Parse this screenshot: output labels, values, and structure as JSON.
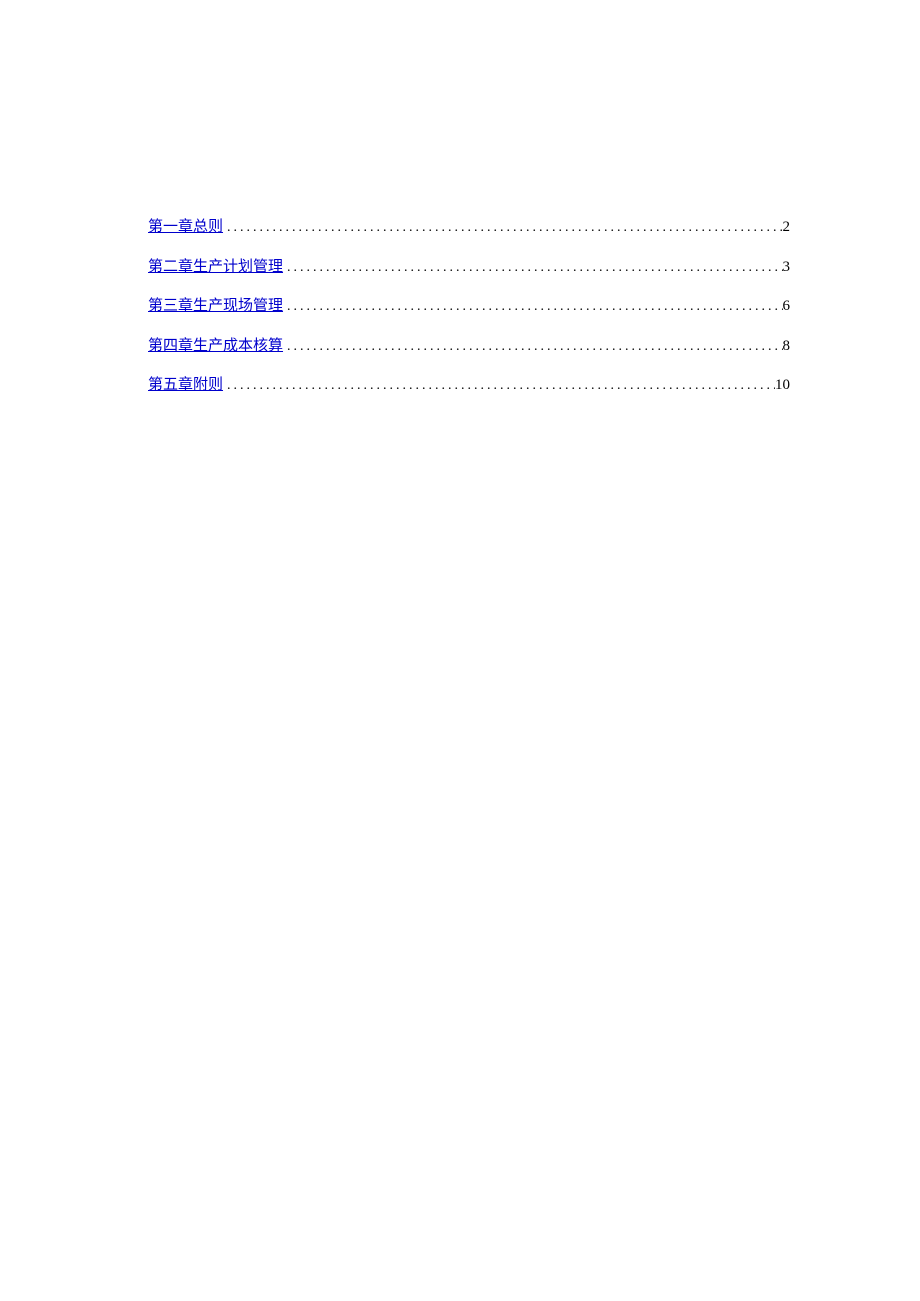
{
  "toc": {
    "entries": [
      {
        "title": "第一章总则",
        "page": "2"
      },
      {
        "title": "第二章生产计划管理",
        "page": "3"
      },
      {
        "title": "第三章生产现场管理",
        "page": "6"
      },
      {
        "title": "第四章生产成本核算",
        "page": "8"
      },
      {
        "title": "第五章附则",
        "page": "10"
      }
    ]
  }
}
